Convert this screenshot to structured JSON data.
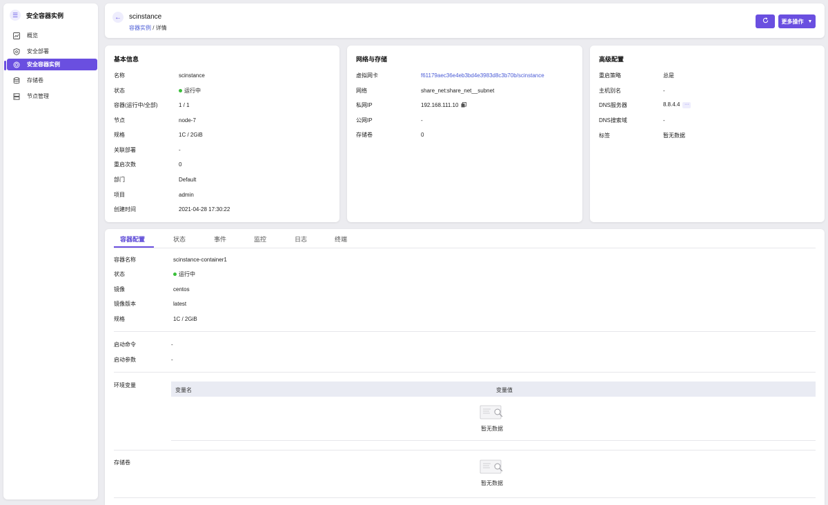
{
  "sidebar": {
    "title": "安全容器实例",
    "items": [
      {
        "label": "概览",
        "icon": "chart-icon"
      },
      {
        "label": "安全部署",
        "icon": "shield-icon"
      },
      {
        "label": "安全容器实例",
        "icon": "gear-icon",
        "active": true
      },
      {
        "label": "存储卷",
        "icon": "database-icon"
      },
      {
        "label": "节点管理",
        "icon": "server-icon"
      }
    ]
  },
  "header": {
    "title": "scinstance",
    "breadcrumb_link": "容器实例",
    "breadcrumb_sep": " / ",
    "breadcrumb_current": "详情",
    "more_label": "更多操作"
  },
  "basic": {
    "heading": "基本信息",
    "rows": [
      {
        "k": "名称",
        "v": "scinstance"
      },
      {
        "k": "状态",
        "v": "运行中"
      },
      {
        "k": "容器(运行中/全部)",
        "v": "1 / 1"
      },
      {
        "k": "节点",
        "v": "node-7"
      },
      {
        "k": "规格",
        "v": "1C / 2GiB"
      },
      {
        "k": "关联部署",
        "v": "-"
      },
      {
        "k": "重启次数",
        "v": "0"
      },
      {
        "k": "部门",
        "v": "Default"
      },
      {
        "k": "项目",
        "v": "admin"
      },
      {
        "k": "创建时间",
        "v": "2021-04-28 17:30:22"
      }
    ]
  },
  "network": {
    "heading": "网络与存储",
    "rows": [
      {
        "k": "虚拟网卡",
        "v": "f61179aec36e4eb3bd4e3983d8c3b70b/scinstance"
      },
      {
        "k": "网络",
        "v": "share_net:share_net__subnet"
      },
      {
        "k": "私网IP",
        "v": "192.168.111.10"
      },
      {
        "k": "公网IP",
        "v": "-"
      },
      {
        "k": "存储卷",
        "v": "0"
      }
    ]
  },
  "advanced": {
    "heading": "高级配置",
    "rows": [
      {
        "k": "重启策略",
        "v": "总是"
      },
      {
        "k": "主机别名",
        "v": "-"
      },
      {
        "k": "DNS服务器",
        "v": "8.8.4.4"
      },
      {
        "k": "DNS搜索域",
        "v": "-"
      },
      {
        "k": "标签",
        "v": "暂无数据"
      }
    ]
  },
  "tabs": [
    "容器配置",
    "状态",
    "事件",
    "监控",
    "日志",
    "终端"
  ],
  "container": {
    "rows": [
      {
        "k": "容器名称",
        "v": "scinstance-container1"
      },
      {
        "k": "状态",
        "v": "运行中"
      },
      {
        "k": "镜像",
        "v": "centos"
      },
      {
        "k": "镜像版本",
        "v": "latest"
      },
      {
        "k": "规格",
        "v": "1C / 2GiB"
      }
    ],
    "start_cmd_label": "启动命令",
    "start_cmd_value": "-",
    "start_args_label": "启动参数",
    "start_args_value": "-",
    "env_label": "环境变量",
    "env_col_name": "变量名",
    "env_col_value": "变量值",
    "env_empty": "暂无数据",
    "volume_label": "存储卷",
    "volume_empty": "暂无数据"
  },
  "colors": {
    "accent": "#6a4fe0",
    "link": "#4a5bd6",
    "running": "#3ac03a"
  }
}
